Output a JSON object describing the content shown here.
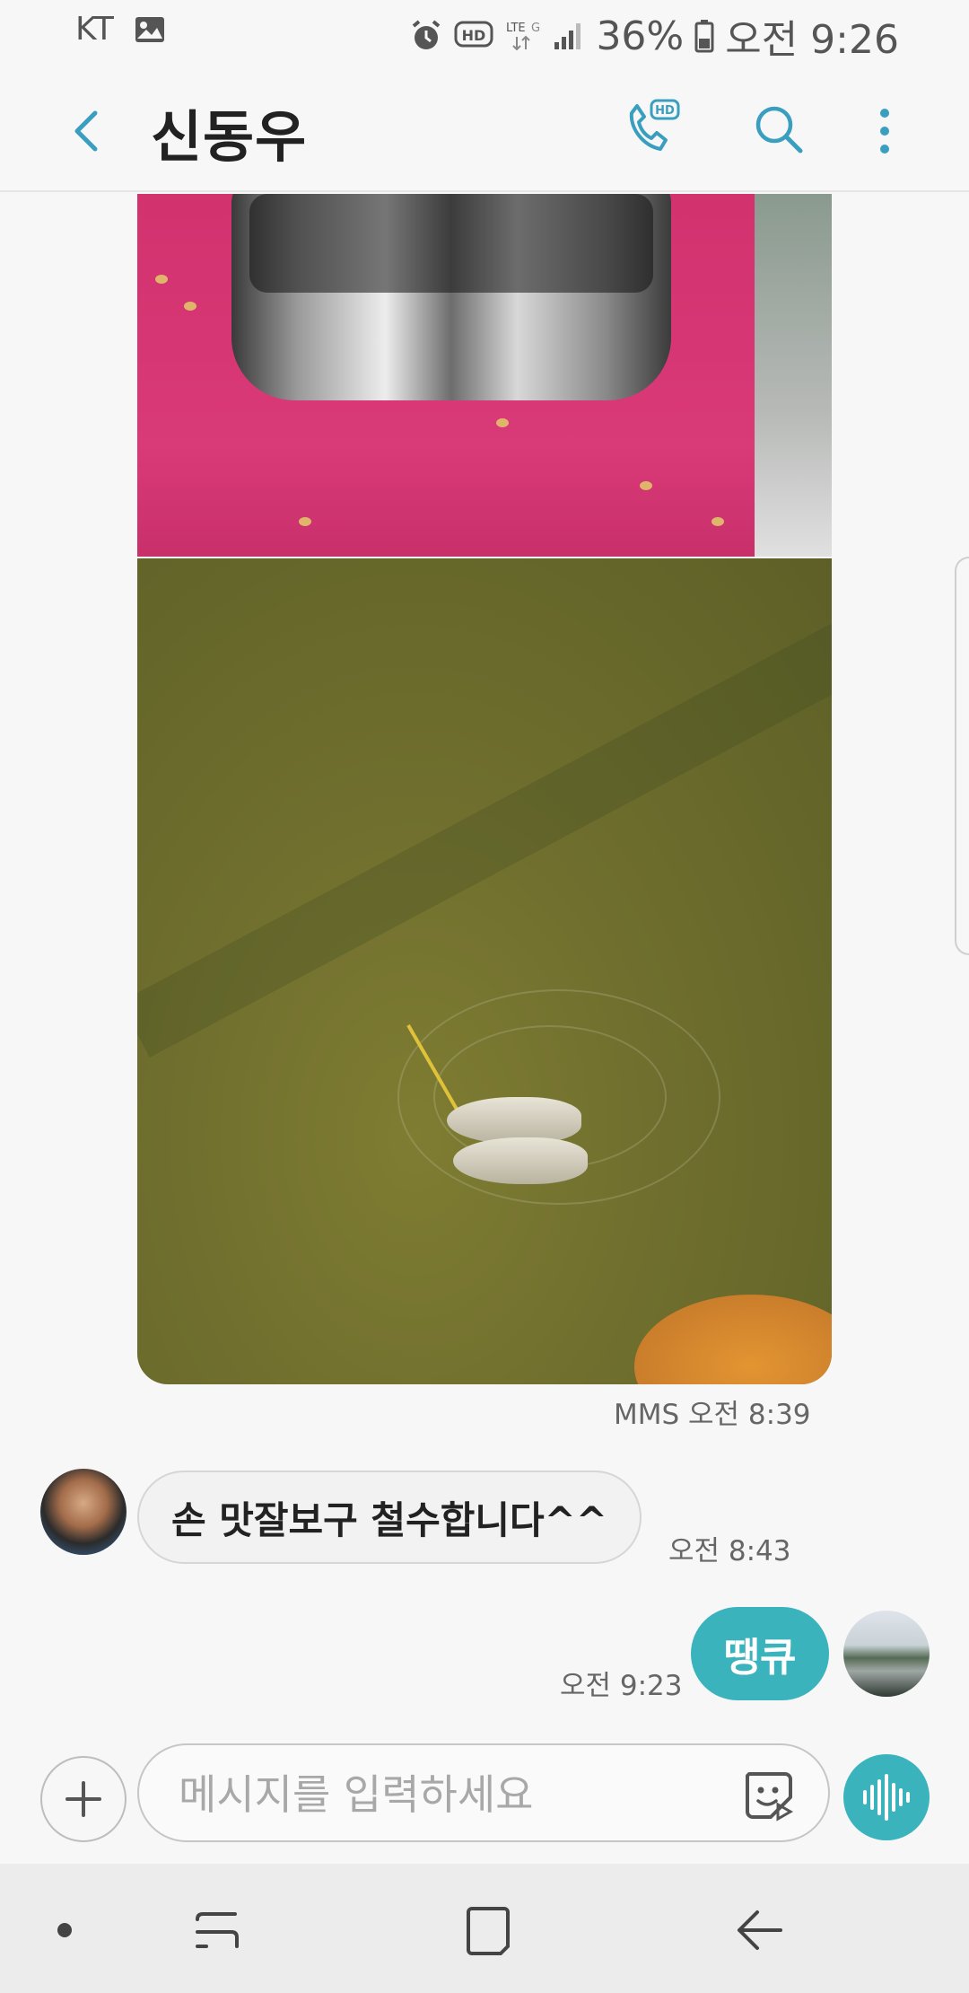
{
  "status_bar": {
    "carrier": "KT",
    "network": "LTE",
    "battery": "36%",
    "time": "오전 9:26"
  },
  "header": {
    "title": "신동우",
    "icons": [
      "back-icon",
      "hd-call-icon",
      "search-icon",
      "more-vert-icon"
    ],
    "call_badge": "HD"
  },
  "conversation": {
    "mms_meta": "MMS 오전 8:39",
    "incoming": {
      "text": "손 맛잘보구  철수합니다^^",
      "time": "오전 8:43"
    },
    "outgoing": {
      "text": "땡큐",
      "time": "오전 9:23"
    }
  },
  "composer": {
    "placeholder": "메시지를 입력하세요",
    "icons": [
      "add-icon",
      "sticker-icon",
      "voice-icon"
    ]
  },
  "nav_bar": {
    "icons": [
      "dot-icon",
      "recents-icon",
      "home-icon",
      "back-arrow-icon"
    ]
  },
  "colors": {
    "accent": "#3bb3bc",
    "header_icon": "#3a9fbf",
    "background": "#f7f7f8"
  }
}
